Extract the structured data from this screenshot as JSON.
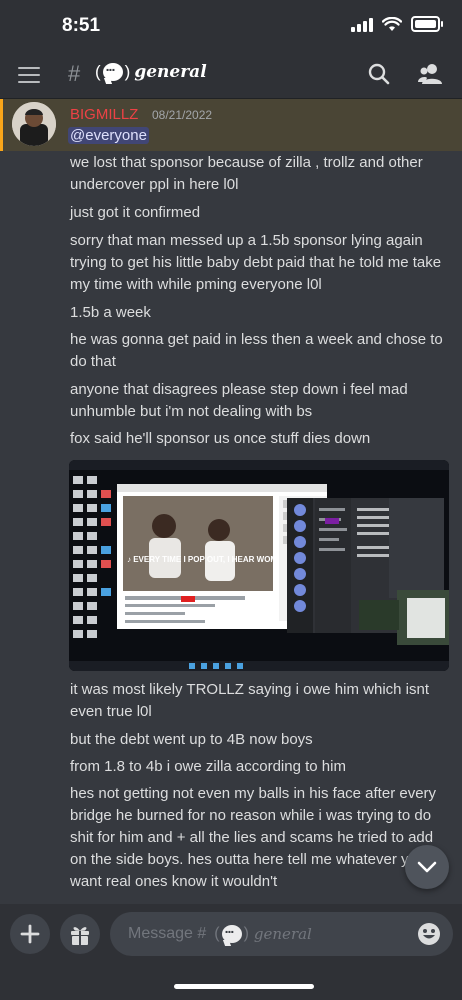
{
  "status": {
    "time": "8:51"
  },
  "header": {
    "channel_name": "general",
    "channel_bracket": "("
  },
  "post": {
    "username": "BIGMILLZ",
    "timestamp": "08/21/2022",
    "mention": "@everyone",
    "messages": [
      "we lost that sponsor because of zilla , trollz and other undercover ppl in here l0l",
      "just got it confirmed",
      "sorry that man messed up a 1.5b sponsor lying again trying to get his little baby debt paid that he told me take my time with while pming everyone l0l",
      "1.5b  a week",
      "he was gonna get paid in less then a week and chose to do that",
      "anyone that disagrees please step down i feel mad unhumble but i'm not dealing with bs",
      "fox said he'll sponsor us once stuff dies down",
      "it was most likely TROLLZ saying i owe him which isnt even true l0l",
      "but the debt went up to 4B now boys",
      "from 1.8 to 4b i owe zilla according to him",
      "hes not getting not even my balls in his face after every bridge he burned for no reason while i was trying to do shit for him and + all the lies and scams he tried to add on the side boys. hes outta here tell me whatever you want real ones know it wouldn't"
    ],
    "attachment": {
      "caption": "♪ EVERY TIME I POP OUT, I HEAR WOMEN SCREAMIN', \"OOH, BABY\" ♪"
    }
  },
  "composer": {
    "placeholder_prefix": "Message #",
    "placeholder_bracket": "(",
    "placeholder_channel": "general"
  },
  "colors": {
    "background": "#36393f",
    "username": "#ed4245",
    "mention_bg": "#414675",
    "highlight_border": "#faa61a"
  },
  "icons": [
    "menu-icon",
    "search-icon",
    "members-icon",
    "chevron-down-icon",
    "plus-icon",
    "gift-icon",
    "emoji-icon"
  ]
}
